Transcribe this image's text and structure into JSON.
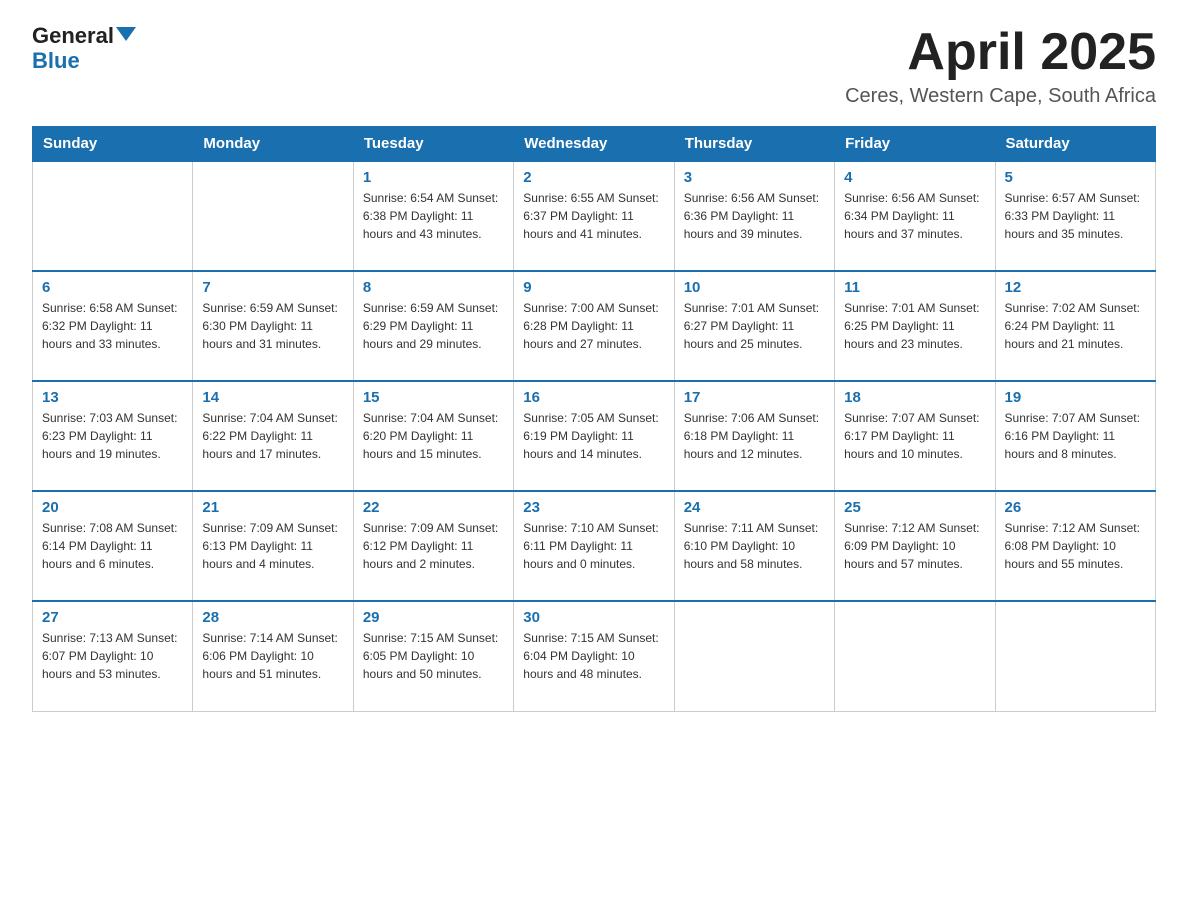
{
  "logo": {
    "text1": "General",
    "text2": "Blue"
  },
  "title": "April 2025",
  "subtitle": "Ceres, Western Cape, South Africa",
  "days_of_week": [
    "Sunday",
    "Monday",
    "Tuesday",
    "Wednesday",
    "Thursday",
    "Friday",
    "Saturday"
  ],
  "weeks": [
    [
      {
        "day": "",
        "info": ""
      },
      {
        "day": "",
        "info": ""
      },
      {
        "day": "1",
        "info": "Sunrise: 6:54 AM\nSunset: 6:38 PM\nDaylight: 11 hours\nand 43 minutes."
      },
      {
        "day": "2",
        "info": "Sunrise: 6:55 AM\nSunset: 6:37 PM\nDaylight: 11 hours\nand 41 minutes."
      },
      {
        "day": "3",
        "info": "Sunrise: 6:56 AM\nSunset: 6:36 PM\nDaylight: 11 hours\nand 39 minutes."
      },
      {
        "day": "4",
        "info": "Sunrise: 6:56 AM\nSunset: 6:34 PM\nDaylight: 11 hours\nand 37 minutes."
      },
      {
        "day": "5",
        "info": "Sunrise: 6:57 AM\nSunset: 6:33 PM\nDaylight: 11 hours\nand 35 minutes."
      }
    ],
    [
      {
        "day": "6",
        "info": "Sunrise: 6:58 AM\nSunset: 6:32 PM\nDaylight: 11 hours\nand 33 minutes."
      },
      {
        "day": "7",
        "info": "Sunrise: 6:59 AM\nSunset: 6:30 PM\nDaylight: 11 hours\nand 31 minutes."
      },
      {
        "day": "8",
        "info": "Sunrise: 6:59 AM\nSunset: 6:29 PM\nDaylight: 11 hours\nand 29 minutes."
      },
      {
        "day": "9",
        "info": "Sunrise: 7:00 AM\nSunset: 6:28 PM\nDaylight: 11 hours\nand 27 minutes."
      },
      {
        "day": "10",
        "info": "Sunrise: 7:01 AM\nSunset: 6:27 PM\nDaylight: 11 hours\nand 25 minutes."
      },
      {
        "day": "11",
        "info": "Sunrise: 7:01 AM\nSunset: 6:25 PM\nDaylight: 11 hours\nand 23 minutes."
      },
      {
        "day": "12",
        "info": "Sunrise: 7:02 AM\nSunset: 6:24 PM\nDaylight: 11 hours\nand 21 minutes."
      }
    ],
    [
      {
        "day": "13",
        "info": "Sunrise: 7:03 AM\nSunset: 6:23 PM\nDaylight: 11 hours\nand 19 minutes."
      },
      {
        "day": "14",
        "info": "Sunrise: 7:04 AM\nSunset: 6:22 PM\nDaylight: 11 hours\nand 17 minutes."
      },
      {
        "day": "15",
        "info": "Sunrise: 7:04 AM\nSunset: 6:20 PM\nDaylight: 11 hours\nand 15 minutes."
      },
      {
        "day": "16",
        "info": "Sunrise: 7:05 AM\nSunset: 6:19 PM\nDaylight: 11 hours\nand 14 minutes."
      },
      {
        "day": "17",
        "info": "Sunrise: 7:06 AM\nSunset: 6:18 PM\nDaylight: 11 hours\nand 12 minutes."
      },
      {
        "day": "18",
        "info": "Sunrise: 7:07 AM\nSunset: 6:17 PM\nDaylight: 11 hours\nand 10 minutes."
      },
      {
        "day": "19",
        "info": "Sunrise: 7:07 AM\nSunset: 6:16 PM\nDaylight: 11 hours\nand 8 minutes."
      }
    ],
    [
      {
        "day": "20",
        "info": "Sunrise: 7:08 AM\nSunset: 6:14 PM\nDaylight: 11 hours\nand 6 minutes."
      },
      {
        "day": "21",
        "info": "Sunrise: 7:09 AM\nSunset: 6:13 PM\nDaylight: 11 hours\nand 4 minutes."
      },
      {
        "day": "22",
        "info": "Sunrise: 7:09 AM\nSunset: 6:12 PM\nDaylight: 11 hours\nand 2 minutes."
      },
      {
        "day": "23",
        "info": "Sunrise: 7:10 AM\nSunset: 6:11 PM\nDaylight: 11 hours\nand 0 minutes."
      },
      {
        "day": "24",
        "info": "Sunrise: 7:11 AM\nSunset: 6:10 PM\nDaylight: 10 hours\nand 58 minutes."
      },
      {
        "day": "25",
        "info": "Sunrise: 7:12 AM\nSunset: 6:09 PM\nDaylight: 10 hours\nand 57 minutes."
      },
      {
        "day": "26",
        "info": "Sunrise: 7:12 AM\nSunset: 6:08 PM\nDaylight: 10 hours\nand 55 minutes."
      }
    ],
    [
      {
        "day": "27",
        "info": "Sunrise: 7:13 AM\nSunset: 6:07 PM\nDaylight: 10 hours\nand 53 minutes."
      },
      {
        "day": "28",
        "info": "Sunrise: 7:14 AM\nSunset: 6:06 PM\nDaylight: 10 hours\nand 51 minutes."
      },
      {
        "day": "29",
        "info": "Sunrise: 7:15 AM\nSunset: 6:05 PM\nDaylight: 10 hours\nand 50 minutes."
      },
      {
        "day": "30",
        "info": "Sunrise: 7:15 AM\nSunset: 6:04 PM\nDaylight: 10 hours\nand 48 minutes."
      },
      {
        "day": "",
        "info": ""
      },
      {
        "day": "",
        "info": ""
      },
      {
        "day": "",
        "info": ""
      }
    ]
  ]
}
